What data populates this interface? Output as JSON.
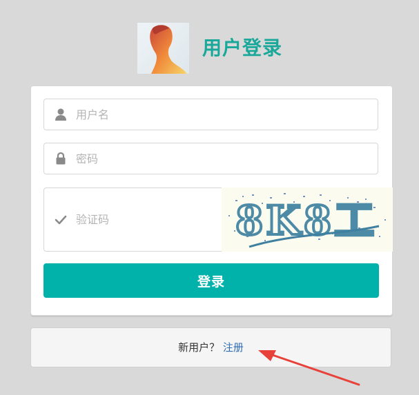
{
  "header": {
    "title": "用户登录"
  },
  "form": {
    "username_placeholder": "用户名",
    "password_placeholder": "密码",
    "captcha_placeholder": "验证码",
    "captcha_image_text": "8K8工",
    "login_label": "登录"
  },
  "register": {
    "prompt": "新用户？",
    "link_label": "注册"
  },
  "icons": {
    "username": "user-icon",
    "password": "lock-icon",
    "captcha": "check-icon"
  },
  "colors": {
    "brand": "#1aa89a",
    "button": "#00b2a9",
    "link": "#2f6db5",
    "annotation_arrow": "#e8413a"
  }
}
